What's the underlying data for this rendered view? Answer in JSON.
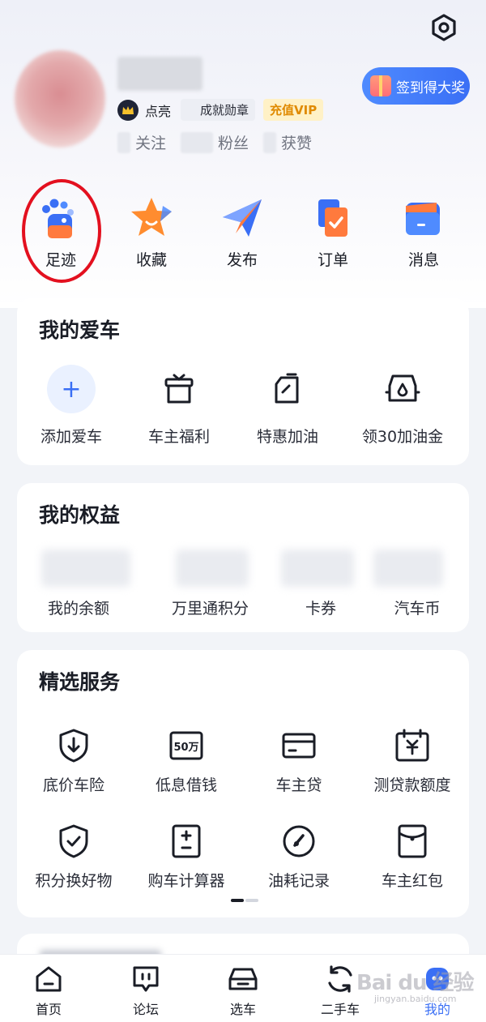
{
  "profile": {
    "badge_label": "点亮",
    "achievement_label": "成就勋章",
    "vip_label": "充值VIP",
    "stats": [
      {
        "label": "关注"
      },
      {
        "label": "粉丝"
      },
      {
        "label": "获赞"
      }
    ],
    "signin_label": "签到得大奖"
  },
  "quick_actions": [
    {
      "label": "足迹",
      "icon": "footprint-icon"
    },
    {
      "label": "收藏",
      "icon": "star-icon"
    },
    {
      "label": "发布",
      "icon": "send-icon"
    },
    {
      "label": "订单",
      "icon": "order-icon"
    },
    {
      "label": "消息",
      "icon": "message-icon"
    }
  ],
  "my_car": {
    "title": "我的爱车",
    "items": [
      {
        "label": "添加爱车",
        "icon": "add-icon"
      },
      {
        "label": "车主福利",
        "icon": "gift-box-icon"
      },
      {
        "label": "特惠加油",
        "icon": "fuel-can-icon"
      },
      {
        "label": "领30加油金",
        "icon": "fuel-pump-icon"
      }
    ]
  },
  "my_rights": {
    "title": "我的权益",
    "items": [
      {
        "label": "我的余额"
      },
      {
        "label": "万里通积分"
      },
      {
        "label": "卡券"
      },
      {
        "label": "汽车币"
      }
    ]
  },
  "services": {
    "title": "精选服务",
    "items": [
      {
        "label": "底价车险",
        "icon": "shield-down-icon"
      },
      {
        "label": "低息借钱",
        "icon": "loan-50w-icon"
      },
      {
        "label": "车主贷",
        "icon": "card-icon"
      },
      {
        "label": "测贷款额度",
        "icon": "calendar-yuan-icon"
      },
      {
        "label": "积分换好物",
        "icon": "shield-check-icon"
      },
      {
        "label": "购车计算器",
        "icon": "calculator-icon"
      },
      {
        "label": "油耗记录",
        "icon": "gauge-icon"
      },
      {
        "label": "车主红包",
        "icon": "red-envelope-icon"
      }
    ]
  },
  "tabbar": [
    {
      "label": "首页",
      "icon": "home-icon"
    },
    {
      "label": "论坛",
      "icon": "forum-icon"
    },
    {
      "label": "选车",
      "icon": "car-icon"
    },
    {
      "label": "二手车",
      "icon": "refresh-icon"
    },
    {
      "label": "我的",
      "icon": "profile-icon"
    }
  ],
  "watermark": {
    "text": "Bai du 经验",
    "sub": "jingyan.baidu.com"
  },
  "colors": {
    "accent": "#3a6ff5",
    "highlight": "#e3101f",
    "vip": "#e08a00"
  }
}
